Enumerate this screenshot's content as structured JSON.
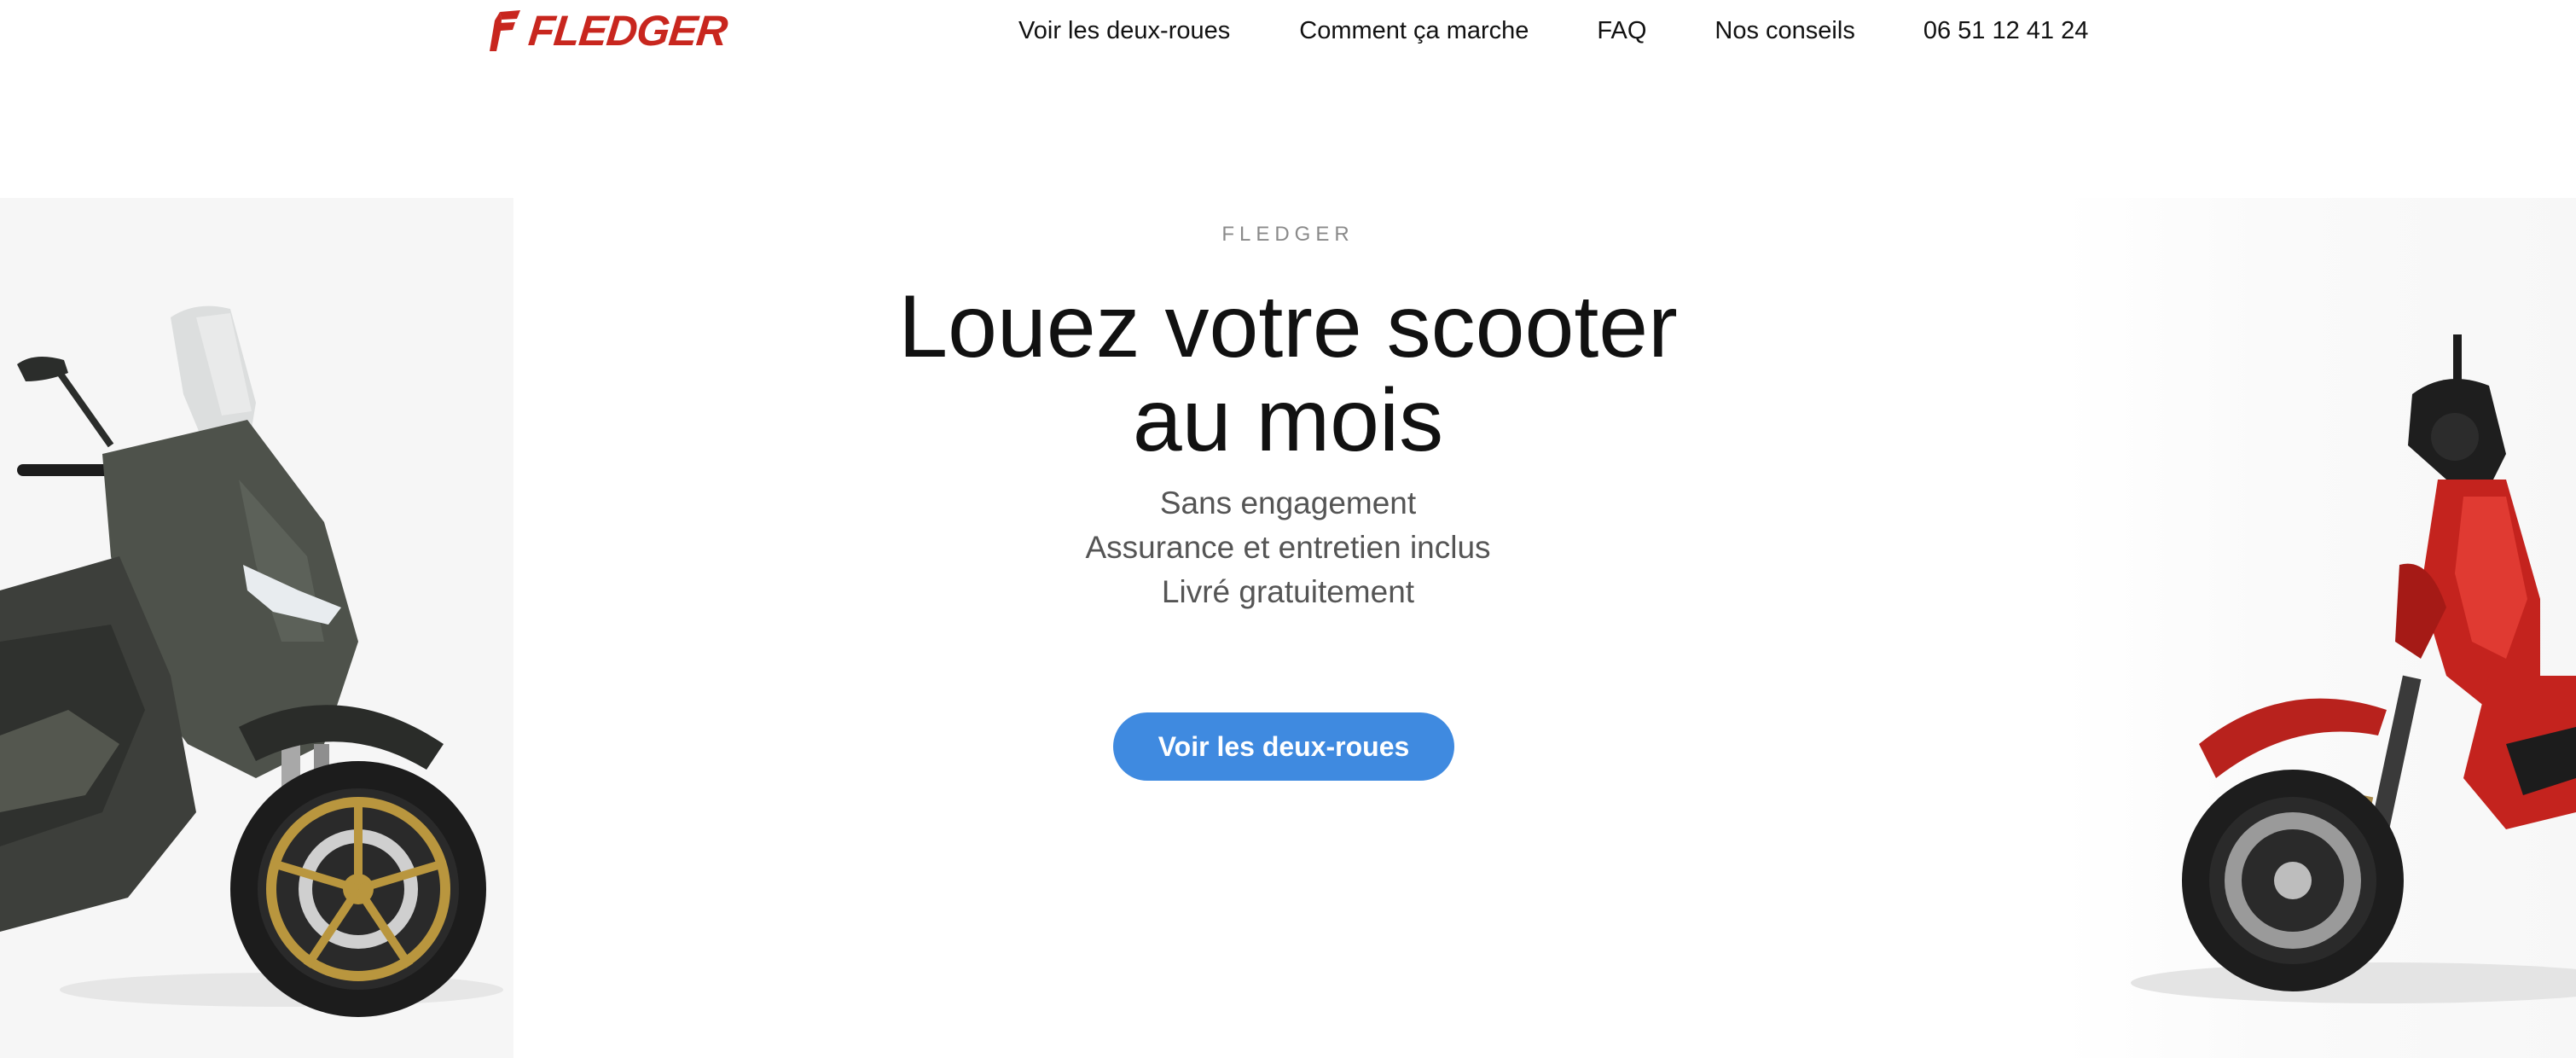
{
  "header": {
    "logo_text": "FLEDGER",
    "nav": [
      {
        "label": "Voir les deux-roues"
      },
      {
        "label": "Comment ça marche"
      },
      {
        "label": "FAQ"
      },
      {
        "label": "Nos conseils"
      },
      {
        "label": "06 51 12 41 24"
      }
    ]
  },
  "hero": {
    "eyebrow": "FLEDGER",
    "headline_line1": "Louez votre scooter",
    "headline_line2": "au mois",
    "features": [
      "Sans engagement",
      "Assurance et entretien inclus",
      "Livré gratuitement"
    ],
    "cta_label": "Voir les deux-roues"
  },
  "colors": {
    "brand_red": "#c8261e",
    "cta_blue": "#3f8ae0",
    "text_dark": "#111111",
    "text_muted": "#555555"
  },
  "icons": {
    "logo_mark": "fledger-logo-icon"
  }
}
